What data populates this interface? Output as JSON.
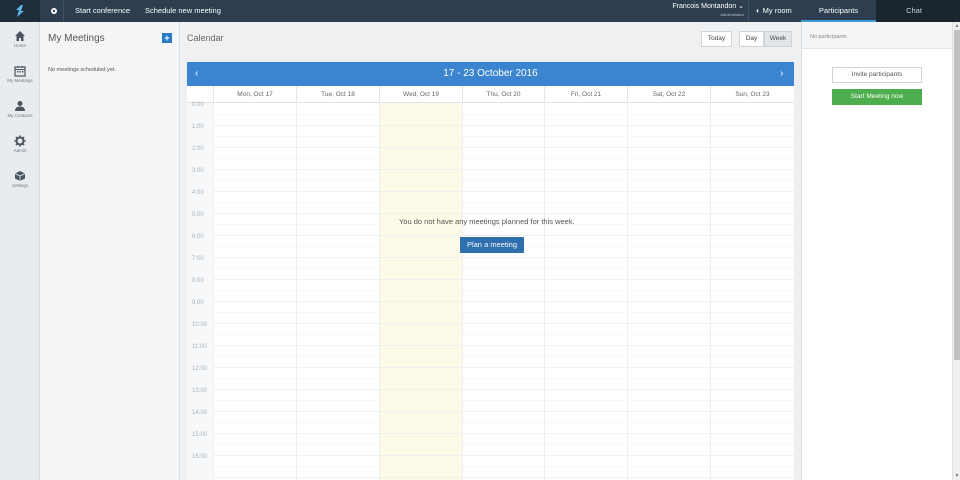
{
  "topbar": {
    "start_conference": "Start conference",
    "schedule_meeting": "Schedule new meeting",
    "user_name": "Francois Montandon",
    "user_role": "Administrator",
    "my_room": "My room",
    "participants_tab": "Participants",
    "chat_tab": "Chat"
  },
  "nav": {
    "items": [
      {
        "label": "Home",
        "icon": "home-icon"
      },
      {
        "label": "My Meetings",
        "icon": "calendar-icon"
      },
      {
        "label": "My Contacts",
        "icon": "user-icon"
      },
      {
        "label": "Admin",
        "icon": "gear-icon"
      },
      {
        "label": "Settings",
        "icon": "cube-icon"
      }
    ]
  },
  "meetings": {
    "title": "My Meetings",
    "add_label": "+",
    "empty_text": "No meetings scheduled yet."
  },
  "calendar": {
    "heading": "Calendar",
    "today": "Today",
    "day": "Day",
    "week": "Week",
    "range": "17 - 23 October 2016",
    "prev": "‹",
    "next": "›",
    "days": [
      "Mon, Oct 17",
      "Tue, Oct 18",
      "Wed, Oct 19",
      "Thu, Oct 20",
      "Fri, Oct 21",
      "Sat, Oct 22",
      "Sun, Oct 23"
    ],
    "times": [
      "0:00",
      "1:00",
      "2:00",
      "3:00",
      "4:00",
      "5:00",
      "6:00",
      "7:00",
      "8:00",
      "9:00",
      "10:00",
      "11:00",
      "12:00",
      "13:00",
      "14:00",
      "15:00",
      "16:00"
    ],
    "empty_message": "You do not have any meetings planned for this week.",
    "plan_button": "Plan a meeting"
  },
  "participants": {
    "none_text": "No participants",
    "invite": "Invite participants",
    "start": "Start Meeting now"
  },
  "colors": {
    "topbar": "#2c3e50",
    "calendar_header": "#3b84cf",
    "start_button": "#4cae4c",
    "today_column": "#fdfbe7"
  }
}
